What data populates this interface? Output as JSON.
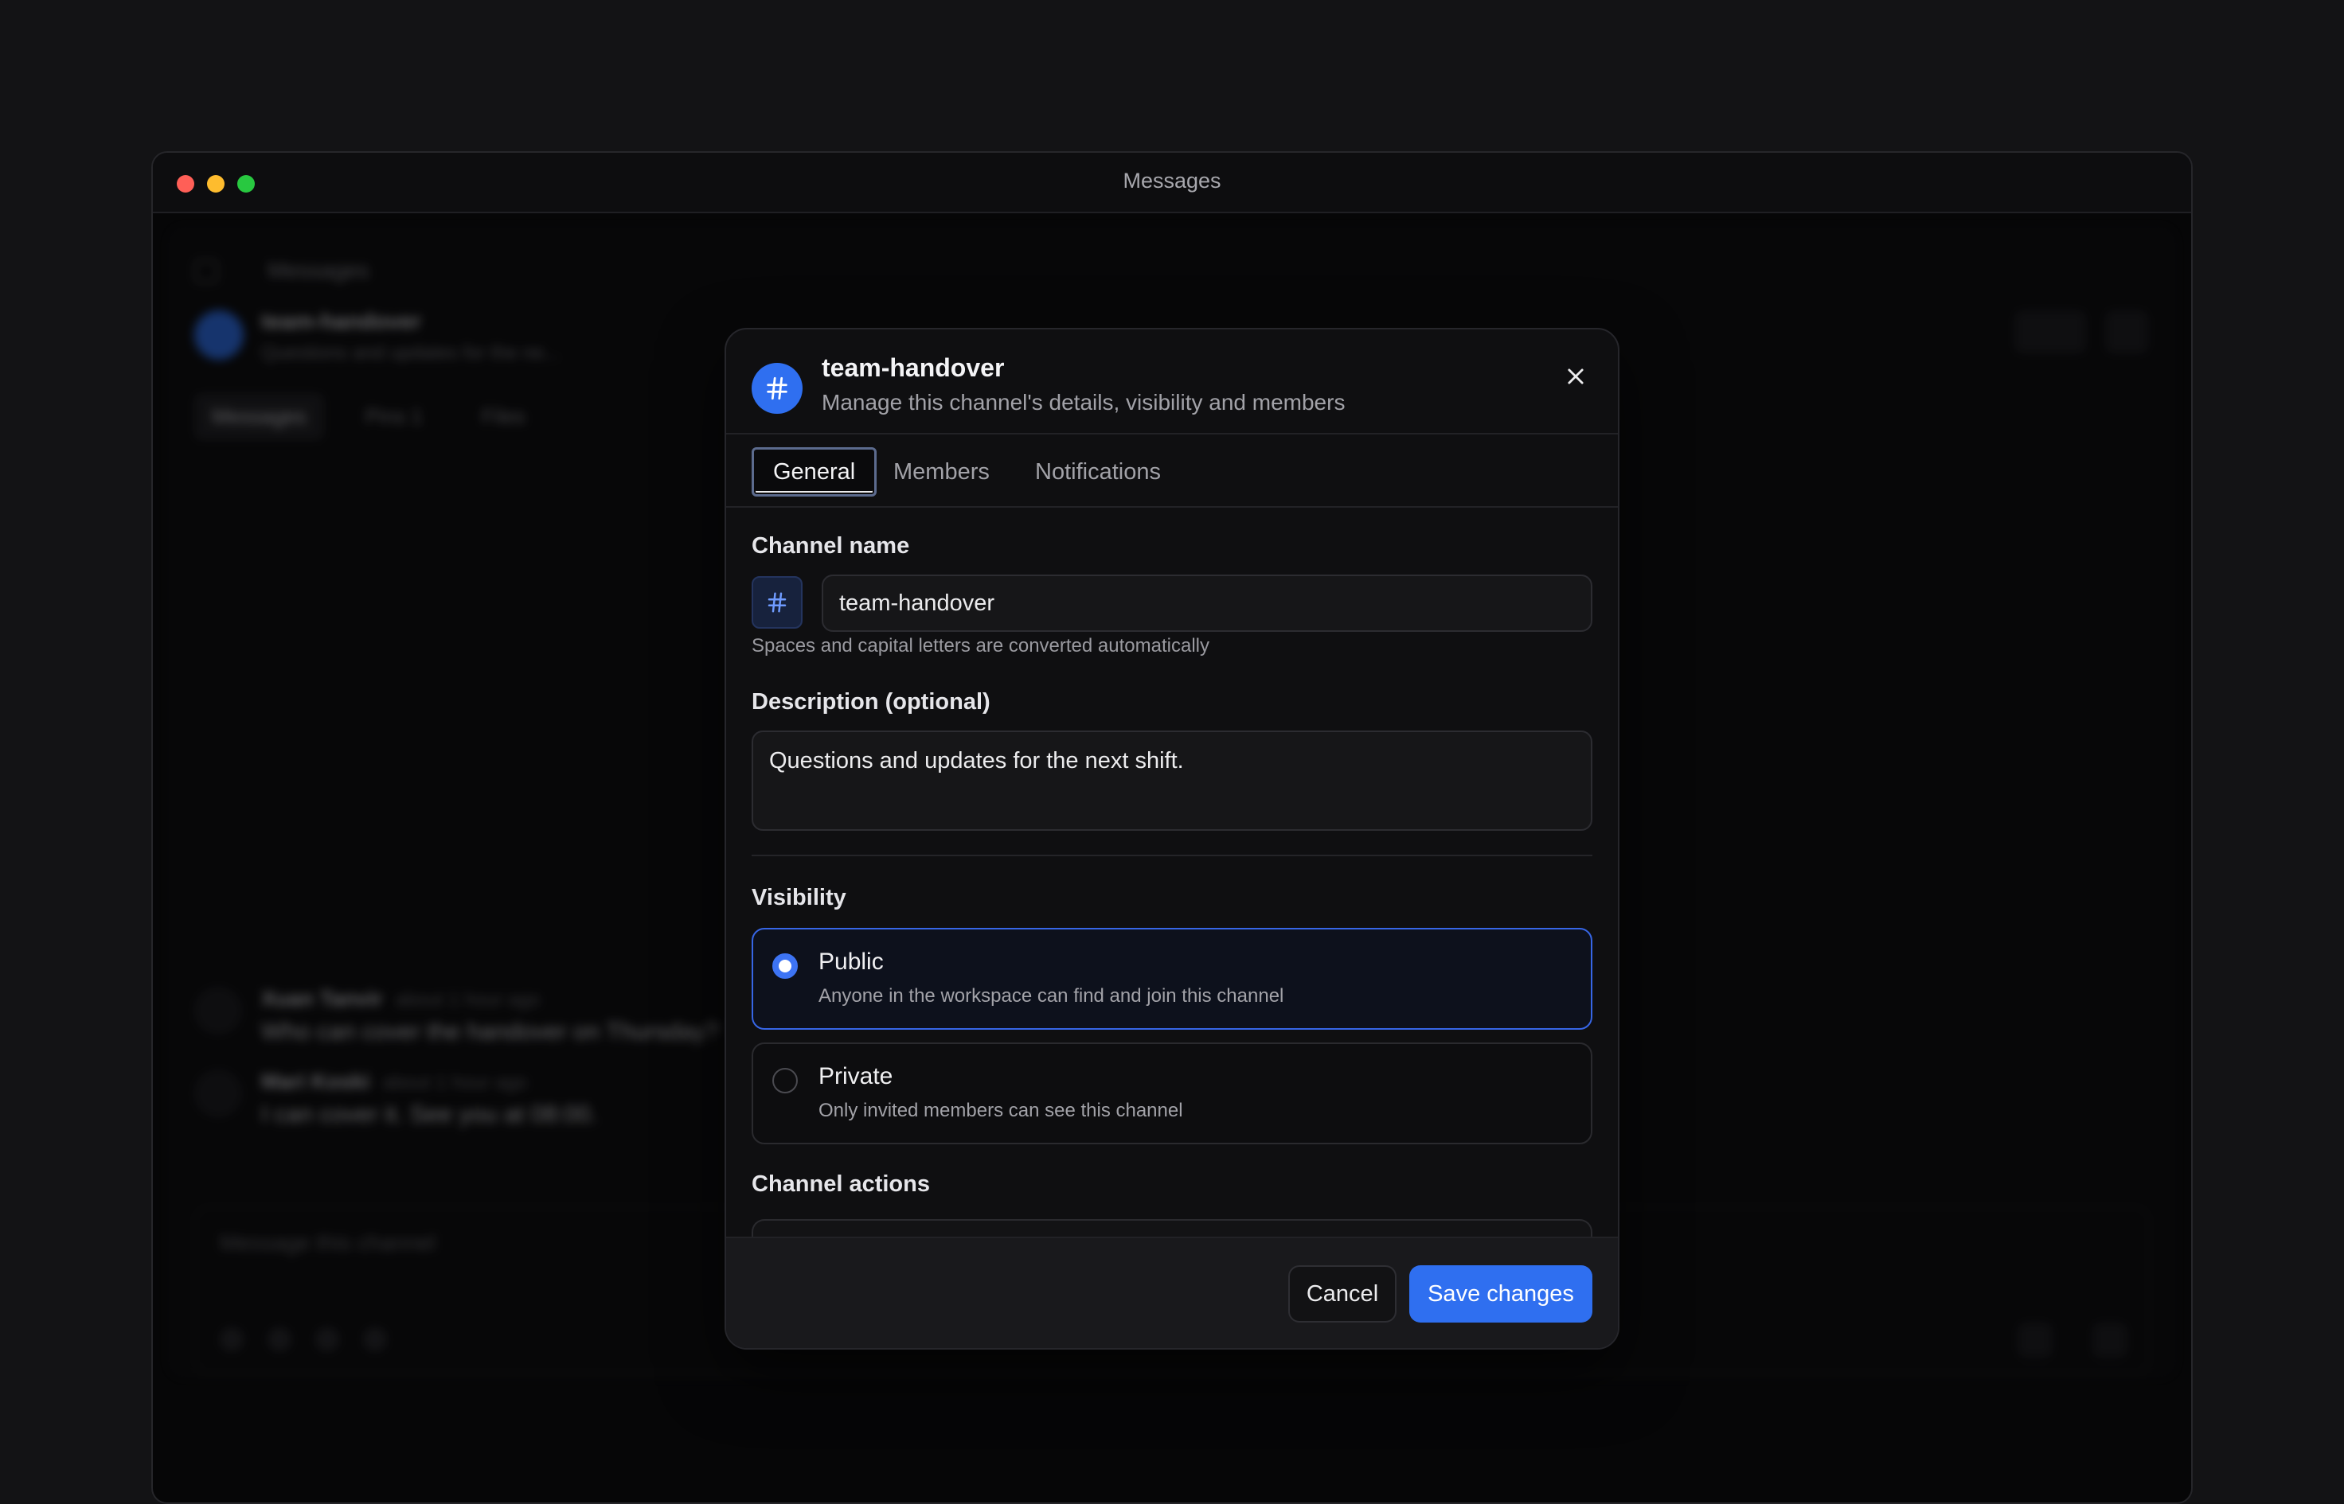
{
  "window": {
    "title": "Messages"
  },
  "background": {
    "breadcrumb": "Messages",
    "channel_title": "team-handover",
    "channel_subtitle": "Questions and updates for the ne...",
    "tabs": [
      {
        "label": "Messages"
      },
      {
        "label": "Pins 1"
      },
      {
        "label": "Files"
      }
    ],
    "messages": [
      {
        "author": "Xuan Tanvir",
        "time": "about 1 hour ago",
        "text": "Who can cover the handover on Thursday?"
      },
      {
        "author": "Mari Koski",
        "time": "about 1 hour ago",
        "text": "I can cover it. See you at 08:00."
      }
    ],
    "composer_placeholder": "Message this channel"
  },
  "modal": {
    "title": "team-handover",
    "subtitle": "Manage this channel's details, visibility and members",
    "tabs": [
      {
        "label": "General",
        "active": true
      },
      {
        "label": "Members",
        "active": false
      },
      {
        "label": "Notifications",
        "active": false
      }
    ],
    "channel_name": {
      "label": "Channel name",
      "prefix": "#",
      "value": "team-handover",
      "hint": "Spaces and capital letters are converted automatically"
    },
    "description": {
      "label": "Description (optional)",
      "value": "Questions and updates for the next shift."
    },
    "visibility": {
      "label": "Visibility",
      "options": [
        {
          "title": "Public",
          "description": "Anyone in the workspace can find and join this channel",
          "selected": true
        },
        {
          "title": "Private",
          "description": "Only invited members can see this channel",
          "selected": false
        }
      ]
    },
    "channel_actions_label": "Channel actions",
    "footer": {
      "cancel": "Cancel",
      "save": "Save changes"
    }
  },
  "colors": {
    "accent": "#2f6ff0",
    "background": "#131315",
    "surface": "#0f0f11"
  }
}
